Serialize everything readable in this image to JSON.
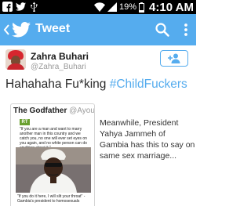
{
  "status_bar": {
    "battery_percent": "19%",
    "time": "4:10 AM",
    "icons": [
      "facebook-icon",
      "twitter-bird-icon",
      "usb-icon",
      "wifi-icon",
      "signal-icon",
      "battery-icon"
    ]
  },
  "action_bar": {
    "title": "Tweet",
    "background": "#55acee"
  },
  "tweet": {
    "display_name": "Zahra Buhari",
    "username": "@Zahra_Buhari",
    "text": "Hahahaha Fu*king ",
    "hashtag": "#ChildFuckers",
    "accent": "#55acee"
  },
  "quoted_card": {
    "author": "The Godfather",
    "handle": "@Ayourb",
    "rt_logo": "RT",
    "quote_top": "\"If you are a man and want to marry another man in this country and we catch you, no one will ever set eyes on you again, and no white person can do anything about it.\"",
    "quote_bottom": "\"If you do it here, I will slit your throat\" - Gambia's president to homosexuals"
  },
  "side_text": "Meanwhile, President Yahya Jammeh of Gambia has this to say on same sex marriage..."
}
